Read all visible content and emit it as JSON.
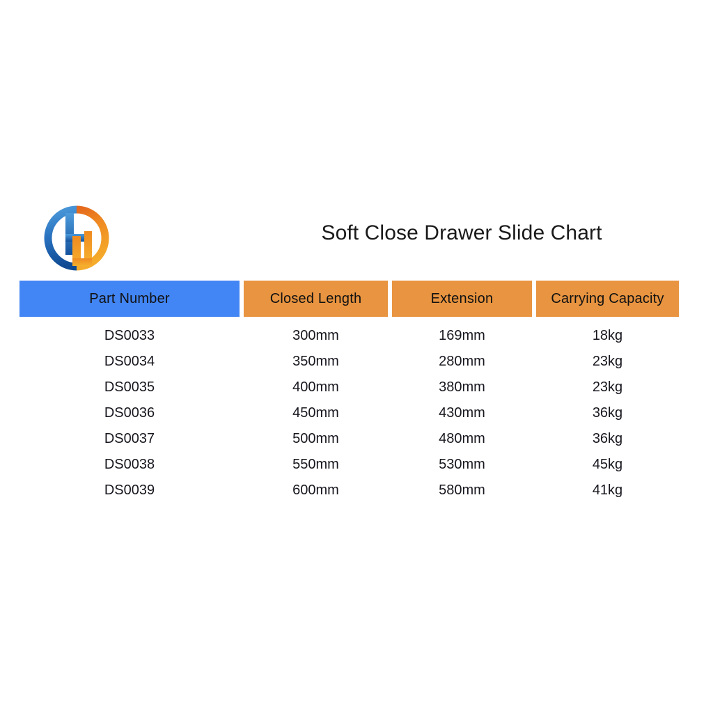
{
  "page": {
    "background": "#ffffff"
  },
  "brand": {
    "logo_name": "company-monogram-logo",
    "logo_colors": {
      "blue_light": "#3d8fd8",
      "blue_dark": "#14519c",
      "orange_light": "#f0a22e",
      "orange_dark": "#e0621c",
      "orange_mid": "#ef8b22"
    }
  },
  "header": {
    "title": "Soft Close Drawer Slide Chart"
  },
  "colors": {
    "header_part_bg": "#4285f4",
    "header_spec_bg": "#e89440",
    "header_text": "#111111",
    "body_text": "#17171f"
  },
  "table": {
    "columns": [
      {
        "key": "part",
        "label": "Part Number"
      },
      {
        "key": "closed",
        "label": "Closed Length"
      },
      {
        "key": "ext",
        "label": "Extension"
      },
      {
        "key": "cap",
        "label": "Carrying Capacity"
      }
    ],
    "rows": [
      {
        "part": "DS0033",
        "closed": "300mm",
        "ext": "169mm",
        "cap": "18kg"
      },
      {
        "part": "DS0034",
        "closed": "350mm",
        "ext": "280mm",
        "cap": "23kg"
      },
      {
        "part": "DS0035",
        "closed": "400mm",
        "ext": "380mm",
        "cap": "23kg"
      },
      {
        "part": "DS0036",
        "closed": "450mm",
        "ext": "430mm",
        "cap": "36kg"
      },
      {
        "part": "DS0037",
        "closed": "500mm",
        "ext": "480mm",
        "cap": "36kg"
      },
      {
        "part": "DS0038",
        "closed": "550mm",
        "ext": "530mm",
        "cap": "45kg"
      },
      {
        "part": "DS0039",
        "closed": "600mm",
        "ext": "580mm",
        "cap": "41kg"
      }
    ]
  },
  "chart_data": {
    "type": "table",
    "title": "Soft Close Drawer Slide Chart",
    "columns": [
      "Part Number",
      "Closed Length",
      "Extension",
      "Carrying Capacity"
    ],
    "rows": [
      [
        "DS0033",
        "300mm",
        "169mm",
        "18kg"
      ],
      [
        "DS0034",
        "350mm",
        "280mm",
        "23kg"
      ],
      [
        "DS0035",
        "400mm",
        "380mm",
        "23kg"
      ],
      [
        "DS0036",
        "450mm",
        "430mm",
        "36kg"
      ],
      [
        "DS0037",
        "500mm",
        "480mm",
        "36kg"
      ],
      [
        "DS0038",
        "550mm",
        "530mm",
        "45kg"
      ],
      [
        "DS0039",
        "600mm",
        "580mm",
        "41kg"
      ]
    ],
    "closed_length_mm": [
      300,
      350,
      400,
      450,
      500,
      550,
      600
    ],
    "extension_mm": [
      169,
      280,
      380,
      430,
      480,
      530,
      580
    ],
    "carrying_capacity_kg": [
      18,
      23,
      23,
      36,
      36,
      45,
      41
    ],
    "part_numbers": [
      "DS0033",
      "DS0034",
      "DS0035",
      "DS0036",
      "DS0037",
      "DS0038",
      "DS0039"
    ]
  }
}
